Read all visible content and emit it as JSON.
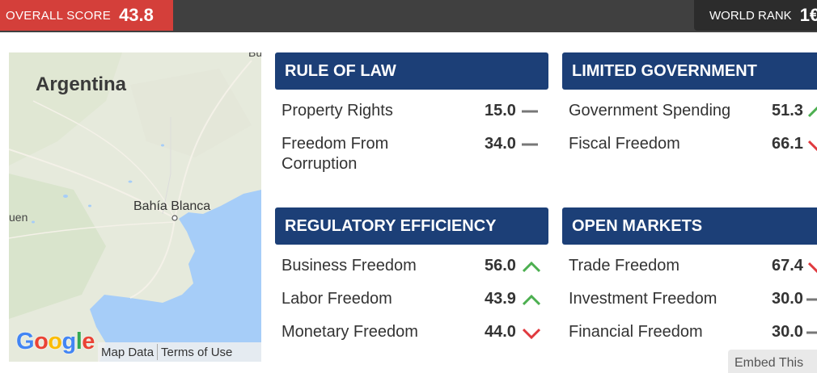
{
  "header": {
    "overall_label": "OVERALL SCORE",
    "overall_value": "43.8",
    "world_rank_label": "WORLD RANK",
    "world_rank_value": "1€",
    "accent_color": "#d43f3a",
    "bar_color": "#404040"
  },
  "map": {
    "country_label": "Argentina",
    "city_label": "Bahía Blanca",
    "edge_label_left": "uen",
    "edge_label_top": "Bu",
    "logo": "Google",
    "map_data_link": "Map Data",
    "terms_link": "Terms of Use"
  },
  "panels": [
    {
      "title": "RULE OF LAW",
      "rows": [
        {
          "name": "Property Rights",
          "score": "15.0",
          "trend": "flat-icon"
        },
        {
          "name": "Freedom From\nCorruption",
          "score": "34.0",
          "trend": "flat-icon"
        }
      ]
    },
    {
      "title": "LIMITED GOVERNMENT",
      "rows": [
        {
          "name": "Government Spending",
          "score": "51.3",
          "trend": "up-icon"
        },
        {
          "name": "Fiscal Freedom",
          "score": "66.1",
          "trend": "down-icon"
        }
      ]
    },
    {
      "title": "REGULATORY EFFICIENCY",
      "rows": [
        {
          "name": "Business Freedom",
          "score": "56.0",
          "trend": "up-icon"
        },
        {
          "name": "Labor Freedom",
          "score": "43.9",
          "trend": "up-icon"
        },
        {
          "name": "Monetary Freedom",
          "score": "44.0",
          "trend": "down-icon"
        }
      ]
    },
    {
      "title": "OPEN MARKETS",
      "rows": [
        {
          "name": "Trade Freedom",
          "score": "67.4",
          "trend": "down-icon"
        },
        {
          "name": "Investment Freedom",
          "score": "30.0",
          "trend": "flat-icon"
        },
        {
          "name": "Financial Freedom",
          "score": "30.0",
          "trend": "flat-icon"
        }
      ]
    }
  ],
  "colors": {
    "panel_header": "#1c3f77",
    "up": "#4caf50",
    "down": "#e0393e",
    "flat": "#777777"
  },
  "embed_label": "Embed This"
}
